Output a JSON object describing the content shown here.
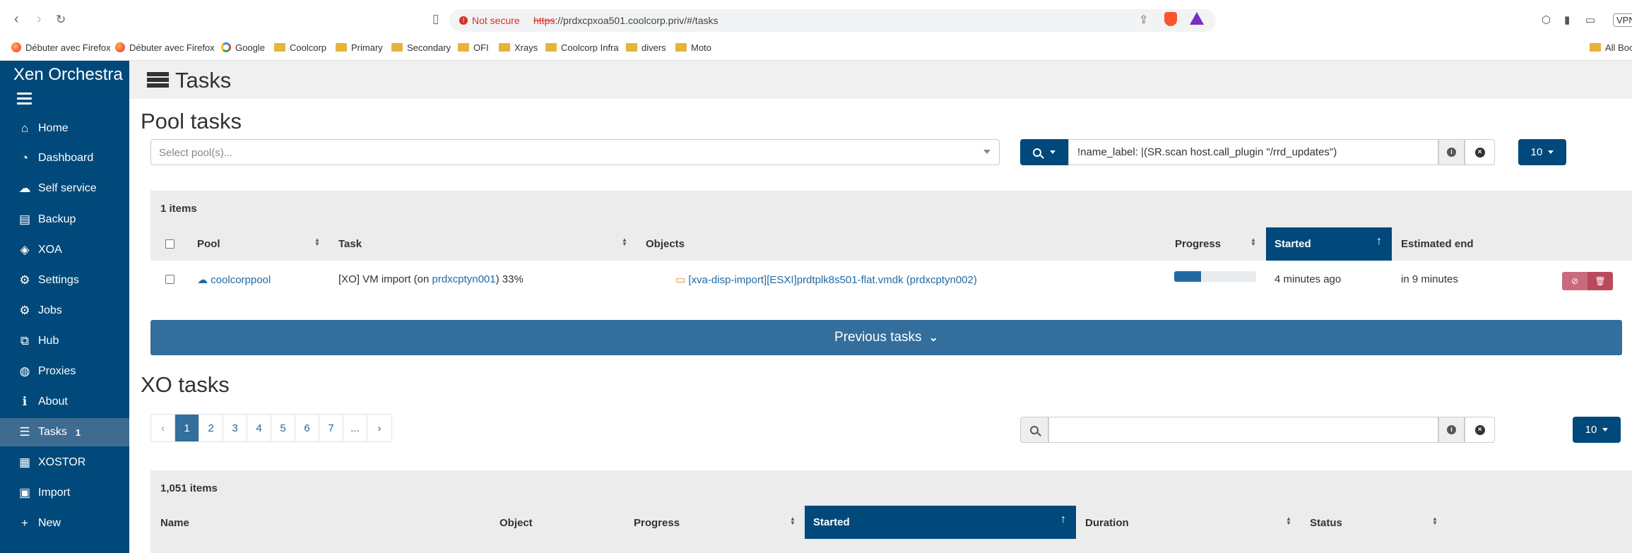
{
  "browser": {
    "not_secure": "Not secure",
    "url_scheme": "https",
    "url_rest": "://prdxcpxoa501.coolcorp.priv/#/tasks",
    "vpn": "VPN",
    "bookmarks": [
      {
        "label": "Débuter avec Firefox",
        "icon": "firefox-icon"
      },
      {
        "label": "Débuter avec Firefox",
        "icon": "firefox-icon"
      },
      {
        "label": "Google",
        "icon": "google-icon"
      },
      {
        "label": "Coolcorp",
        "icon": "folder-icon"
      },
      {
        "label": "Primary",
        "icon": "folder-icon"
      },
      {
        "label": "Secondary",
        "icon": "folder-icon"
      },
      {
        "label": "OFI",
        "icon": "folder-icon"
      },
      {
        "label": "Xrays",
        "icon": "folder-icon"
      },
      {
        "label": "Coolcorp Infra",
        "icon": "folder-icon"
      },
      {
        "label": "divers",
        "icon": "folder-icon"
      },
      {
        "label": "Moto",
        "icon": "folder-icon"
      }
    ],
    "all_bookmarks": "All Boo"
  },
  "sidebar": {
    "brand": "Xen Orchestra",
    "items": [
      {
        "label": "Home",
        "icon": "home-icon"
      },
      {
        "label": "Dashboard",
        "icon": "dashboard-icon"
      },
      {
        "label": "Self service",
        "icon": "cloud-icon"
      },
      {
        "label": "Backup",
        "icon": "archive-icon"
      },
      {
        "label": "XOA",
        "icon": "cube-icon"
      },
      {
        "label": "Settings",
        "icon": "gear-icon"
      },
      {
        "label": "Jobs",
        "icon": "gears-icon"
      },
      {
        "label": "Hub",
        "icon": "cubes-icon"
      },
      {
        "label": "Proxies",
        "icon": "globe-icon"
      },
      {
        "label": "About",
        "icon": "info-icon"
      },
      {
        "label": "Tasks",
        "icon": "tasks-icon",
        "badge": "1"
      },
      {
        "label": "XOSTOR",
        "icon": "database-icon"
      },
      {
        "label": "Import",
        "icon": "file-icon"
      },
      {
        "label": "New",
        "icon": "plus-icon"
      }
    ]
  },
  "page": {
    "title": "Tasks"
  },
  "pool_tasks": {
    "heading": "Pool tasks",
    "select_placeholder": "Select pool(s)...",
    "filter": "!name_label: |(SR.scan host.call_plugin \"/rrd_updates\")",
    "page_size": "10",
    "items_count": "1 items",
    "columns": [
      "Pool",
      "Task",
      "Objects",
      "Progress",
      "Started",
      "Estimated end"
    ],
    "rows": [
      {
        "pool": "coolcorppool",
        "task_prefix": "[XO] VM import (on ",
        "task_host": "prdxcptyn001",
        "task_suffix": ") 33%",
        "object": "[xva-disp-import][ESXI]prdtplk8s501-flat.vmdk (prdxcptyn002)",
        "progress": 0.33,
        "started": "4 minutes ago",
        "estimated_end": "in 9 minutes"
      }
    ],
    "previous_label": "Previous tasks"
  },
  "xo_tasks": {
    "heading": "XO tasks",
    "pages": [
      "‹",
      "1",
      "2",
      "3",
      "4",
      "5",
      "6",
      "7",
      "...",
      "›"
    ],
    "active_page": "1",
    "search_value": "",
    "page_size": "10",
    "items_count": "1,051 items",
    "columns": [
      "Name",
      "Object",
      "Progress",
      "Started",
      "Duration",
      "Status"
    ]
  },
  "colors": {
    "primary": "#00497a",
    "sidebar_active": "#406b91",
    "link": "#1f6aa5",
    "danger": "#c96b7c"
  }
}
